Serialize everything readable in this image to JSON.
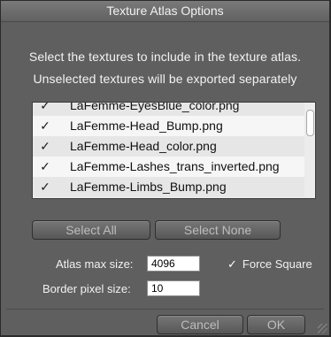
{
  "dialog": {
    "title": "Texture Atlas Options",
    "instruction_line1": "Select the textures to include in the texture atlas.",
    "instruction_line2": "Unselected textures will be exported separately"
  },
  "texture_list": {
    "items": [
      {
        "label": "LaFemme-EyesBlue_color.png",
        "checked": true,
        "check_glyph": "✓"
      },
      {
        "label": "LaFemme-Head_Bump.png",
        "checked": true,
        "check_glyph": "✓"
      },
      {
        "label": "LaFemme-Head_color.png",
        "checked": true,
        "check_glyph": "✓"
      },
      {
        "label": "LaFemme-Lashes_trans_inverted.png",
        "checked": true,
        "check_glyph": "✓"
      },
      {
        "label": "LaFemme-Limbs_Bump.png",
        "checked": true,
        "check_glyph": "✓"
      }
    ]
  },
  "selection_buttons": {
    "select_all": "Select All",
    "select_none": "Select None"
  },
  "atlas_settings": {
    "atlas_max_size_label": "Atlas max size:",
    "atlas_max_size_value": "4096",
    "force_square_label": "Force Square",
    "force_square_checked": true,
    "force_square_glyph": "✓",
    "border_pixel_size_label": "Border pixel size:",
    "border_pixel_size_value": "10"
  },
  "footer": {
    "cancel": "Cancel",
    "ok": "OK"
  },
  "colors": {
    "dialog_bg": "#5f5f5f",
    "list_bg": "#ececec",
    "button_text": "#bdbdbd"
  }
}
